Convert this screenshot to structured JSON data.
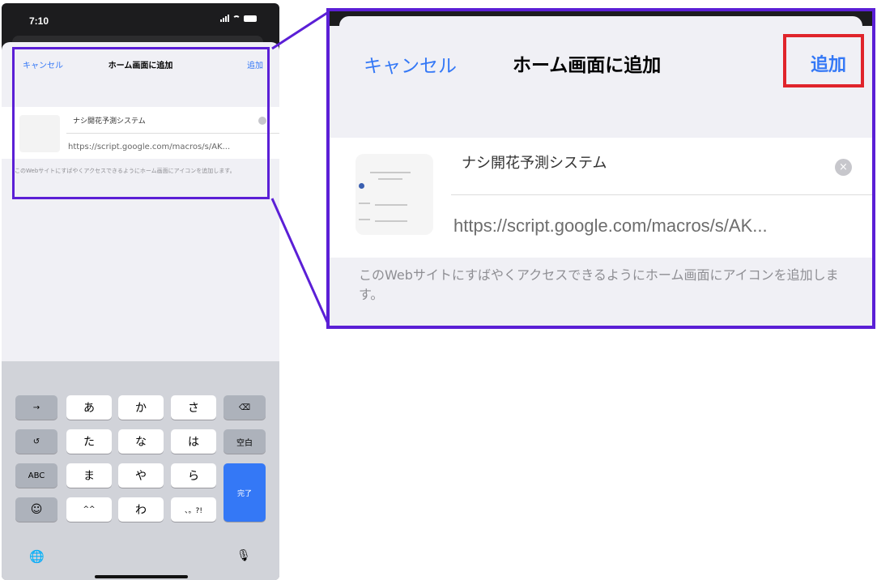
{
  "status_bar": {
    "time": "7:10"
  },
  "dialog": {
    "cancel_label": "キャンセル",
    "title": "ホーム画面に追加",
    "add_label": "追加",
    "app_name": "ナシ開花予測システム",
    "url": "https://script.google.com/macros/s/AK...",
    "description": "このWebサイトにすばやくアクセスできるようにホーム画面にアイコンを追加します。"
  },
  "keyboard": {
    "row1": [
      "→",
      "あ",
      "か",
      "さ",
      "⌫"
    ],
    "row2": [
      "↺",
      "た",
      "な",
      "は",
      "空白"
    ],
    "row3": [
      "ABC",
      "ま",
      "や",
      "ら"
    ],
    "row4": [
      "☺",
      "^^",
      "わ",
      "、。?!"
    ],
    "done_label": "完了",
    "globe": "🌐",
    "mic": "🎙"
  },
  "colors": {
    "ios_blue": "#3478f6",
    "highlight_purple": "#5b1fd6",
    "callout_red": "#e0242b"
  }
}
